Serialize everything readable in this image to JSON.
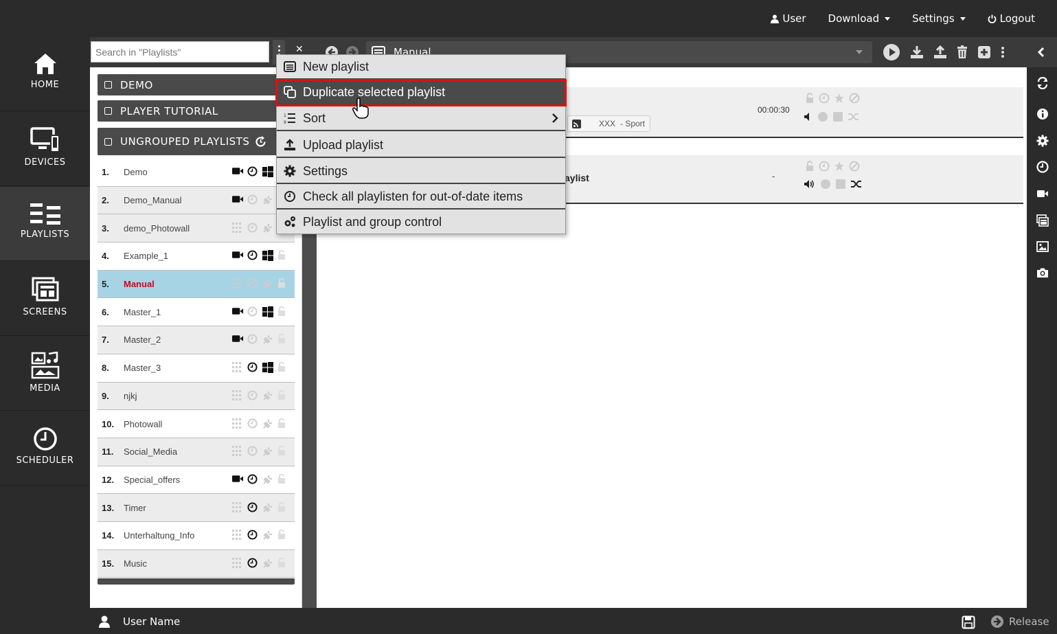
{
  "topnav": {
    "user": "User",
    "download": "Download",
    "settings": "Settings",
    "logout": "Logout"
  },
  "leftnav": [
    {
      "label": "HOME",
      "icon": "home-icon"
    },
    {
      "label": "DEVICES",
      "icon": "devices-icon"
    },
    {
      "label": "PLAYLISTS",
      "icon": "playlists-icon",
      "active": true
    },
    {
      "label": "SCREENS",
      "icon": "screens-icon"
    },
    {
      "label": "MEDIA",
      "icon": "media-icon"
    },
    {
      "label": "SCHEDULER",
      "icon": "scheduler-icon"
    }
  ],
  "search": {
    "placeholder": "Search in \"Playlists\""
  },
  "groups": {
    "demo": "DEMO",
    "player_tutorial": "PLAYER TUTORIAL",
    "ungrouped": "UNGROUPED PLAYLISTS"
  },
  "playlists": [
    {
      "num": "1.",
      "name": "Demo"
    },
    {
      "num": "2.",
      "name": "Demo_Manual"
    },
    {
      "num": "3.",
      "name": "demo_Photowall"
    },
    {
      "num": "4.",
      "name": "Example_1"
    },
    {
      "num": "5.",
      "name": "Manual",
      "selected": true
    },
    {
      "num": "6.",
      "name": "Master_1"
    },
    {
      "num": "7.",
      "name": "Master_2"
    },
    {
      "num": "8.",
      "name": "Master_3"
    },
    {
      "num": "9.",
      "name": "njkj"
    },
    {
      "num": "10.",
      "name": "Photowall"
    },
    {
      "num": "11.",
      "name": "Social_Media"
    },
    {
      "num": "12.",
      "name": "Special_offers"
    },
    {
      "num": "13.",
      "name": "Timer"
    },
    {
      "num": "14.",
      "name": "Unterhaltung_Info"
    },
    {
      "num": "15.",
      "name": "Music"
    }
  ],
  "toolbar": {
    "selected_playlist": "Manual"
  },
  "entries": {
    "first": {
      "duration": "00:00:30",
      "tag_text": "XXX",
      "tag_sub": "- Sport"
    },
    "second": {
      "title_fragment": "aylist",
      "duration": "-"
    }
  },
  "menu": {
    "new_playlist": "New playlist",
    "duplicate": "Duplicate selected playlist",
    "sort": "Sort",
    "upload": "Upload playlist",
    "settings": "Settings",
    "check": "Check all playlisten for out-of-date items",
    "control": "Playlist and group control"
  },
  "bottombar": {
    "user_name": "User Name",
    "release": "Release"
  },
  "colors": {
    "accent_highlight": "#e01010",
    "selected_row": "#a6d4e4",
    "selected_name": "#d0021b"
  }
}
